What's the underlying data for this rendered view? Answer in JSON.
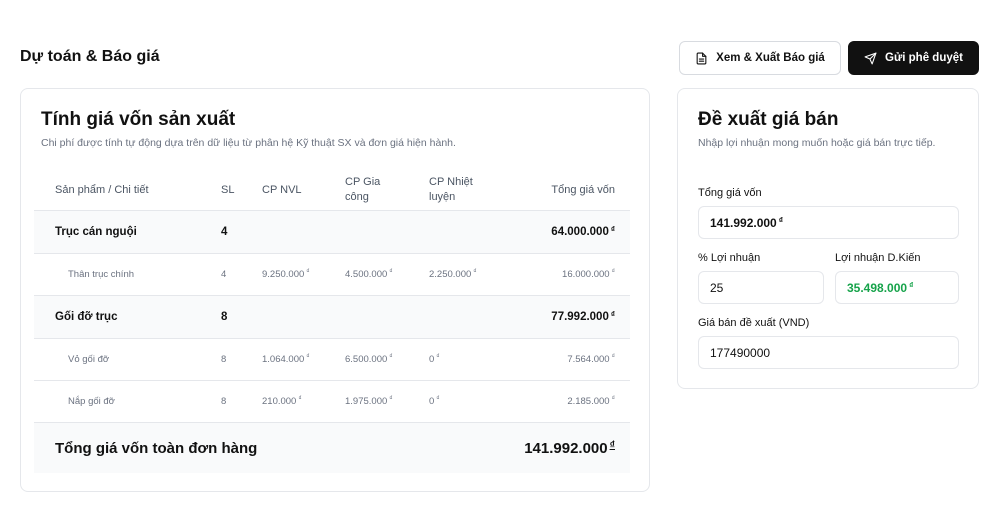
{
  "header": {
    "title": "Dự toán & Báo giá",
    "preview_button": "Xem & Xuất Báo giá",
    "submit_button": "Gửi phê duyệt"
  },
  "cost_card": {
    "title": "Tính giá vốn sản xuất",
    "subtitle": "Chi phí được tính tự động dựa trên dữ liệu từ phân hệ Kỹ thuật SX và đơn giá hiện hành.",
    "columns": {
      "product": "Sản phẩm / Chi tiết",
      "qty": "SL",
      "nvl": "CP NVL",
      "processing": "CP Gia công",
      "heat": "CP Nhiệt luyện",
      "total": "Tổng giá vốn"
    },
    "rows": [
      {
        "type": "group",
        "name": "Trục cán nguội",
        "qty": "4",
        "nvl": "",
        "processing": "",
        "heat": "",
        "total": "64.000.000"
      },
      {
        "type": "detail",
        "name": "Thân trục chính",
        "qty": "4",
        "nvl": "9.250.000",
        "processing": "4.500.000",
        "heat": "2.250.000",
        "total": "16.000.000"
      },
      {
        "type": "group",
        "name": "Gối đỡ trục",
        "qty": "8",
        "nvl": "",
        "processing": "",
        "heat": "",
        "total": "77.992.000"
      },
      {
        "type": "detail",
        "name": "Vỏ gối đỡ",
        "qty": "8",
        "nvl": "1.064.000",
        "processing": "6.500.000",
        "heat": "0",
        "total": "7.564.000"
      },
      {
        "type": "detail",
        "name": "Nắp gối đỡ",
        "qty": "8",
        "nvl": "210.000",
        "processing": "1.975.000",
        "heat": "0",
        "total": "2.185.000"
      }
    ],
    "total_label": "Tổng giá vốn toàn đơn hàng",
    "total_value": "141.992.000",
    "currency": "₫"
  },
  "price_card": {
    "title": "Đề xuất giá bán",
    "subtitle": "Nhập lợi nhuận mong muốn hoặc giá bán trực tiếp.",
    "cost_label": "Tổng giá vốn",
    "cost_value": "141.992.000",
    "profit_pct_label": "% Lợi nhuận",
    "profit_pct_value": "25",
    "profit_est_label": "Lợi nhuận D.Kiến",
    "profit_est_value": "35.498.000",
    "price_label": "Giá bán đề xuất (VND)",
    "price_value": "177490000",
    "currency": "₫"
  },
  "colors": {
    "dark_button": "#111111",
    "profit_green": "#16a34a",
    "border": "#e5e7eb",
    "group_row_bg": "#f9fafb"
  }
}
